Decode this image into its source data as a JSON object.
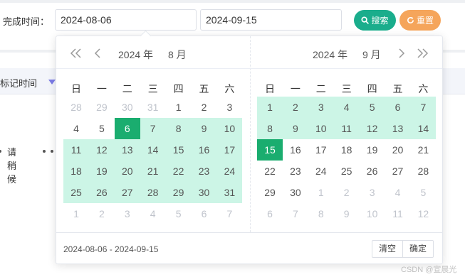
{
  "filter": {
    "label": "完成时间：",
    "start_value": "2024-08-06",
    "end_value": "2024-09-15"
  },
  "buttons": {
    "search": {
      "label": "搜索",
      "icon": "search-icon",
      "color": "#1aad8c"
    },
    "reset": {
      "label": "重置",
      "icon": "refresh-icon",
      "color": "#f5a55b"
    }
  },
  "background": {
    "column_label": "标记时间",
    "loading_text": "请稍候"
  },
  "picker": {
    "accent": "#1aad6f",
    "range_color": "#ccf5e6",
    "weekdays": [
      "日",
      "一",
      "二",
      "三",
      "四",
      "五",
      "六"
    ],
    "left": {
      "year_label": "2024 年",
      "month_label": "8 月",
      "rows": [
        [
          {
            "d": "28",
            "s": "other"
          },
          {
            "d": "29",
            "s": "other"
          },
          {
            "d": "30",
            "s": "other"
          },
          {
            "d": "31",
            "s": "other"
          },
          {
            "d": "1",
            "s": ""
          },
          {
            "d": "2",
            "s": ""
          },
          {
            "d": "3",
            "s": ""
          }
        ],
        [
          {
            "d": "4",
            "s": ""
          },
          {
            "d": "5",
            "s": ""
          },
          {
            "d": "6",
            "s": "selected"
          },
          {
            "d": "7",
            "s": "inrange"
          },
          {
            "d": "8",
            "s": "inrange"
          },
          {
            "d": "9",
            "s": "inrange"
          },
          {
            "d": "10",
            "s": "inrange"
          }
        ],
        [
          {
            "d": "11",
            "s": "inrange"
          },
          {
            "d": "12",
            "s": "inrange"
          },
          {
            "d": "13",
            "s": "inrange"
          },
          {
            "d": "14",
            "s": "inrange"
          },
          {
            "d": "15",
            "s": "inrange"
          },
          {
            "d": "16",
            "s": "inrange"
          },
          {
            "d": "17",
            "s": "inrange"
          }
        ],
        [
          {
            "d": "18",
            "s": "inrange"
          },
          {
            "d": "19",
            "s": "inrange"
          },
          {
            "d": "20",
            "s": "inrange"
          },
          {
            "d": "21",
            "s": "inrange"
          },
          {
            "d": "22",
            "s": "inrange"
          },
          {
            "d": "23",
            "s": "inrange"
          },
          {
            "d": "24",
            "s": "inrange"
          }
        ],
        [
          {
            "d": "25",
            "s": "inrange"
          },
          {
            "d": "26",
            "s": "inrange"
          },
          {
            "d": "27",
            "s": "inrange"
          },
          {
            "d": "28",
            "s": "inrange"
          },
          {
            "d": "29",
            "s": "inrange"
          },
          {
            "d": "30",
            "s": "inrange"
          },
          {
            "d": "31",
            "s": "inrange"
          }
        ],
        [
          {
            "d": "1",
            "s": "other"
          },
          {
            "d": "2",
            "s": "other"
          },
          {
            "d": "3",
            "s": "other"
          },
          {
            "d": "4",
            "s": "other"
          },
          {
            "d": "5",
            "s": "other"
          },
          {
            "d": "6",
            "s": "other"
          },
          {
            "d": "7",
            "s": "other"
          }
        ]
      ]
    },
    "right": {
      "year_label": "2024 年",
      "month_label": "9 月",
      "rows": [
        [
          {
            "d": "1",
            "s": "inrange"
          },
          {
            "d": "2",
            "s": "inrange"
          },
          {
            "d": "3",
            "s": "inrange"
          },
          {
            "d": "4",
            "s": "inrange"
          },
          {
            "d": "5",
            "s": "inrange"
          },
          {
            "d": "6",
            "s": "inrange"
          },
          {
            "d": "7",
            "s": "inrange"
          }
        ],
        [
          {
            "d": "8",
            "s": "inrange"
          },
          {
            "d": "9",
            "s": "inrange"
          },
          {
            "d": "10",
            "s": "inrange"
          },
          {
            "d": "11",
            "s": "inrange"
          },
          {
            "d": "12",
            "s": "inrange"
          },
          {
            "d": "13",
            "s": "inrange"
          },
          {
            "d": "14",
            "s": "inrange"
          }
        ],
        [
          {
            "d": "15",
            "s": "selected"
          },
          {
            "d": "16",
            "s": ""
          },
          {
            "d": "17",
            "s": ""
          },
          {
            "d": "18",
            "s": ""
          },
          {
            "d": "19",
            "s": ""
          },
          {
            "d": "20",
            "s": ""
          },
          {
            "d": "21",
            "s": ""
          }
        ],
        [
          {
            "d": "22",
            "s": ""
          },
          {
            "d": "23",
            "s": ""
          },
          {
            "d": "24",
            "s": ""
          },
          {
            "d": "25",
            "s": ""
          },
          {
            "d": "26",
            "s": ""
          },
          {
            "d": "27",
            "s": ""
          },
          {
            "d": "28",
            "s": ""
          }
        ],
        [
          {
            "d": "29",
            "s": ""
          },
          {
            "d": "30",
            "s": ""
          },
          {
            "d": "1",
            "s": "other"
          },
          {
            "d": "2",
            "s": "other"
          },
          {
            "d": "3",
            "s": "other"
          },
          {
            "d": "4",
            "s": "other"
          },
          {
            "d": "5",
            "s": "other"
          }
        ],
        [
          {
            "d": "6",
            "s": "other"
          },
          {
            "d": "7",
            "s": "other"
          },
          {
            "d": "8",
            "s": "other"
          },
          {
            "d": "9",
            "s": "other"
          },
          {
            "d": "10",
            "s": "other"
          },
          {
            "d": "11",
            "s": "other"
          },
          {
            "d": "12",
            "s": "other"
          }
        ]
      ]
    },
    "footer": {
      "range_text": "2024-08-06 - 2024-09-15",
      "clear_label": "清空",
      "confirm_label": "确定"
    }
  },
  "watermark": "CSDN @宣晨光"
}
